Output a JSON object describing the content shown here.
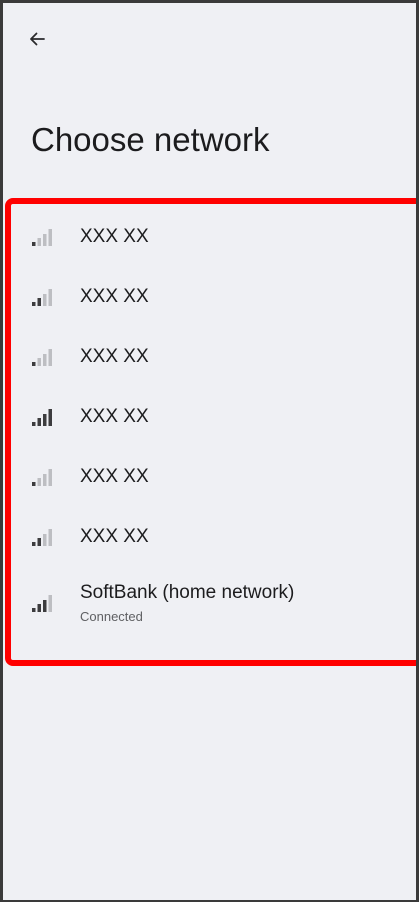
{
  "header": {
    "back_icon": "arrow-back-icon",
    "title": "Choose network"
  },
  "networks": [
    {
      "name": "XXX XX",
      "status": "",
      "signal_level": 1,
      "icon": "signal-icon"
    },
    {
      "name": "XXX XX",
      "status": "",
      "signal_level": 2,
      "icon": "signal-icon"
    },
    {
      "name": "XXX XX",
      "status": "",
      "signal_level": 1,
      "icon": "signal-icon"
    },
    {
      "name": "XXX XX",
      "status": "",
      "signal_level": 4,
      "icon": "signal-icon"
    },
    {
      "name": "XXX XX",
      "status": "",
      "signal_level": 1,
      "icon": "signal-icon"
    },
    {
      "name": "XXX XX",
      "status": "",
      "signal_level": 2,
      "icon": "signal-icon"
    },
    {
      "name": "SoftBank (home network)",
      "status": "Connected",
      "signal_level": 3,
      "icon": "signal-icon"
    }
  ],
  "colors": {
    "background": "#eff0f4",
    "text_primary": "#1c1c1e",
    "text_secondary": "#5f6063",
    "signal_active": "#3c3c3e",
    "signal_inactive": "#bdbec2",
    "highlight": "#ff0000"
  }
}
